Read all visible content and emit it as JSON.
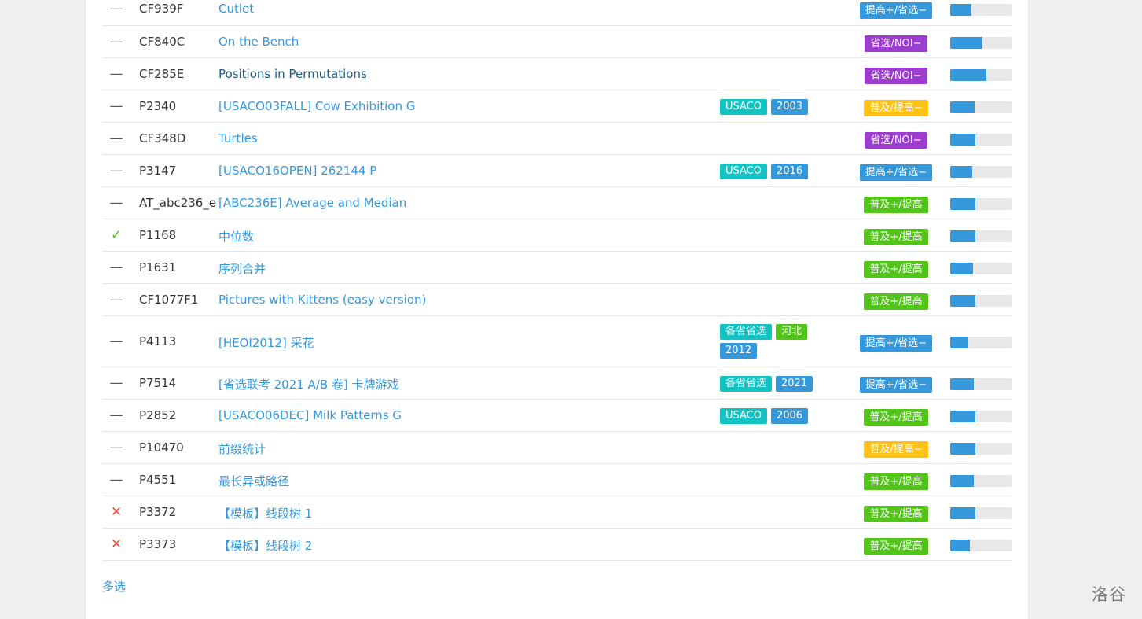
{
  "problems": [
    {
      "status": "none",
      "pid": "CF939F",
      "title": "Cutlet",
      "tags": [],
      "difficulty": "提高+/省选−",
      "diff_color": "#3498db",
      "pass_rate": 0.34
    },
    {
      "status": "none",
      "pid": "CF840C",
      "title": "On the Bench",
      "tags": [],
      "difficulty": "省选/NOI−",
      "diff_color": "#9d3dcf",
      "pass_rate": 0.52
    },
    {
      "status": "none",
      "pid": "CF285E",
      "title": "Positions in Permutations",
      "tags": [],
      "difficulty": "省选/NOI−",
      "diff_color": "#9d3dcf",
      "pass_rate": 0.58
    },
    {
      "status": "none",
      "pid": "P2340",
      "title": "[USACO03FALL] Cow Exhibition G",
      "tags": [
        {
          "label": "USACO",
          "color": "#13c2c2"
        },
        {
          "label": "2003",
          "color": "#3498db"
        }
      ],
      "difficulty": "普及/提高−",
      "diff_color": "#ffc116",
      "pass_rate": 0.39
    },
    {
      "status": "none",
      "pid": "CF348D",
      "title": "Turtles",
      "tags": [],
      "difficulty": "省选/NOI−",
      "diff_color": "#9d3dcf",
      "pass_rate": 0.41
    },
    {
      "status": "none",
      "pid": "P3147",
      "title": "[USACO16OPEN] 262144 P",
      "tags": [
        {
          "label": "USACO",
          "color": "#13c2c2"
        },
        {
          "label": "2016",
          "color": "#3498db"
        }
      ],
      "difficulty": "提高+/省选−",
      "diff_color": "#3498db",
      "pass_rate": 0.36
    },
    {
      "status": "none",
      "pid": "AT_abc236_e",
      "title": "[ABC236E] Average and Median",
      "tags": [],
      "difficulty": "普及+/提高",
      "diff_color": "#52c41a",
      "pass_rate": 0.4
    },
    {
      "status": "ac",
      "pid": "P1168",
      "title": "中位数",
      "tags": [],
      "difficulty": "普及+/提高",
      "diff_color": "#52c41a",
      "pass_rate": 0.4
    },
    {
      "status": "none",
      "pid": "P1631",
      "title": "序列合并",
      "tags": [],
      "difficulty": "普及+/提高",
      "diff_color": "#52c41a",
      "pass_rate": 0.37
    },
    {
      "status": "none",
      "pid": "CF1077F1",
      "title": "Pictures with Kittens (easy version)",
      "tags": [],
      "difficulty": "普及+/提高",
      "diff_color": "#52c41a",
      "pass_rate": 0.4
    },
    {
      "status": "none",
      "pid": "P4113",
      "title": "[HEOI2012] 采花",
      "tags": [
        {
          "label": "各省省选",
          "color": "#13c2c2"
        },
        {
          "label": "河北",
          "color": "#52c41a"
        },
        {
          "label": "2012",
          "color": "#3498db"
        }
      ],
      "difficulty": "提高+/省选−",
      "diff_color": "#3498db",
      "pass_rate": 0.29
    },
    {
      "status": "none",
      "pid": "P7514",
      "title": "[省选联考 2021 A/B 卷] 卡牌游戏",
      "tags": [
        {
          "label": "各省省选",
          "color": "#13c2c2"
        },
        {
          "label": "2021",
          "color": "#3498db"
        }
      ],
      "difficulty": "提高+/省选−",
      "diff_color": "#3498db",
      "pass_rate": 0.38
    },
    {
      "status": "none",
      "pid": "P2852",
      "title": "[USACO06DEC] Milk Patterns G",
      "tags": [
        {
          "label": "USACO",
          "color": "#13c2c2"
        },
        {
          "label": "2006",
          "color": "#3498db"
        }
      ],
      "difficulty": "普及+/提高",
      "diff_color": "#52c41a",
      "pass_rate": 0.4
    },
    {
      "status": "none",
      "pid": "P10470",
      "title": "前缀统计",
      "tags": [],
      "difficulty": "普及/提高−",
      "diff_color": "#ffc116",
      "pass_rate": 0.41
    },
    {
      "status": "none",
      "pid": "P4551",
      "title": "最长异或路径",
      "tags": [],
      "difficulty": "普及+/提高",
      "diff_color": "#52c41a",
      "pass_rate": 0.38
    },
    {
      "status": "wa",
      "pid": "P3372",
      "title": "【模板】线段树 1",
      "tags": [],
      "difficulty": "普及+/提高",
      "diff_color": "#52c41a",
      "pass_rate": 0.4
    },
    {
      "status": "wa",
      "pid": "P3373",
      "title": "【模板】线段树 2",
      "tags": [],
      "difficulty": "普及+/提高",
      "diff_color": "#52c41a",
      "pass_rate": 0.32
    }
  ],
  "footer": {
    "multi_select": "多选"
  },
  "watermark": "洛谷"
}
